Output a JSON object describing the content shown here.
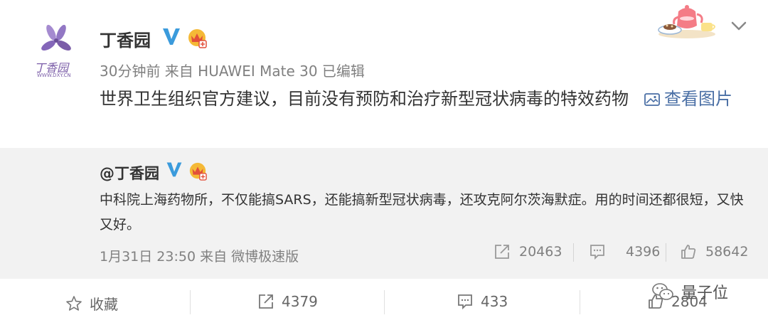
{
  "post": {
    "username": "丁香园",
    "avatar_logo_text": "丁香园",
    "avatar_logo_sub": "WWW.DXY.CN",
    "meta": "30分钟前 来自 HUAWEI Mate 30 已编辑",
    "text": "世界卫生组织官方建议，目前没有预防和治疗新型冠状病毒的特效药物",
    "view_image_label": "查看图片",
    "verified_color": "#3b9bdc",
    "link_color": "#4a6fa5"
  },
  "retweet": {
    "username": "@丁香园",
    "text": "中科院上海药物所，不仅能搞SARS，还能搞新型冠状病毒，还攻克阿尔茨海默症。用的时间还都很短，又快又好。",
    "meta": "1月31日 23:50 来自 微博极速版",
    "reposts": "20463",
    "comments": "4396",
    "likes": "58642"
  },
  "actions": {
    "favorite_label": "收藏",
    "reposts": "4379",
    "comments": "433",
    "likes": "2804"
  },
  "watermark": {
    "text": "量子位"
  }
}
